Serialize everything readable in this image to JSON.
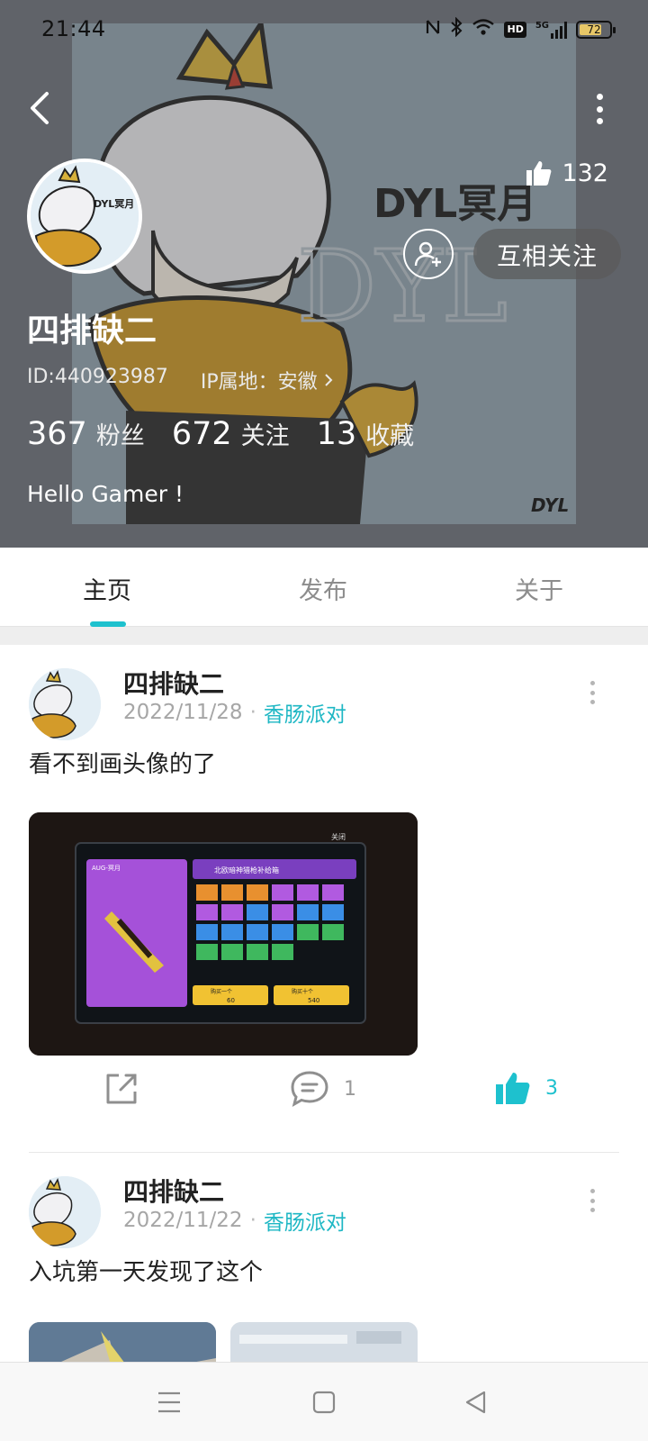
{
  "status_bar": {
    "time": "21:44",
    "battery_level": "72",
    "icons": [
      "nfc-icon",
      "bluetooth-icon",
      "wifi-icon",
      "hd-icon",
      "5g-signal-icon",
      "battery-icon"
    ],
    "hd_label": "HD",
    "network_label": "5G"
  },
  "header": {
    "banner_text": "DYL冥月",
    "banner_watermark": "DYL",
    "banner_sign": "DYL",
    "like_count": "132",
    "mutual_follow_label": "互相关注"
  },
  "profile": {
    "name": "四排缺二",
    "id_text": "ID:440923987",
    "ip_text": "IP属地：安徽",
    "stats": [
      {
        "value": "367",
        "label": "粉丝"
      },
      {
        "value": "672",
        "label": "关注"
      },
      {
        "value": "13",
        "label": "收藏"
      }
    ],
    "bio": "Hello Gamer !"
  },
  "tabs": [
    {
      "label": "主页",
      "active": true
    },
    {
      "label": "发布",
      "active": false
    },
    {
      "label": "关于",
      "active": false
    }
  ],
  "posts": [
    {
      "author": "四排缺二",
      "date": "2022/11/28",
      "separator": "·",
      "topic": "香肠派对",
      "text": "看不到画头像的了",
      "share_count": "",
      "comment_count": "1",
      "like_count": "3",
      "image_labels": {
        "close": "关闭",
        "panel_title": "北欧暗神猎枪补给箱",
        "weapon": "AUG-冥月",
        "btn_one": "购买一个",
        "btn_ten": "购买十个",
        "cost_one": "60",
        "cost_ten": "540"
      }
    },
    {
      "author": "四排缺二",
      "date": "2022/11/22",
      "separator": "·",
      "topic": "香肠派对",
      "text": "入坑第一天发现了这个"
    }
  ],
  "accent_color": "#1ec1ce"
}
